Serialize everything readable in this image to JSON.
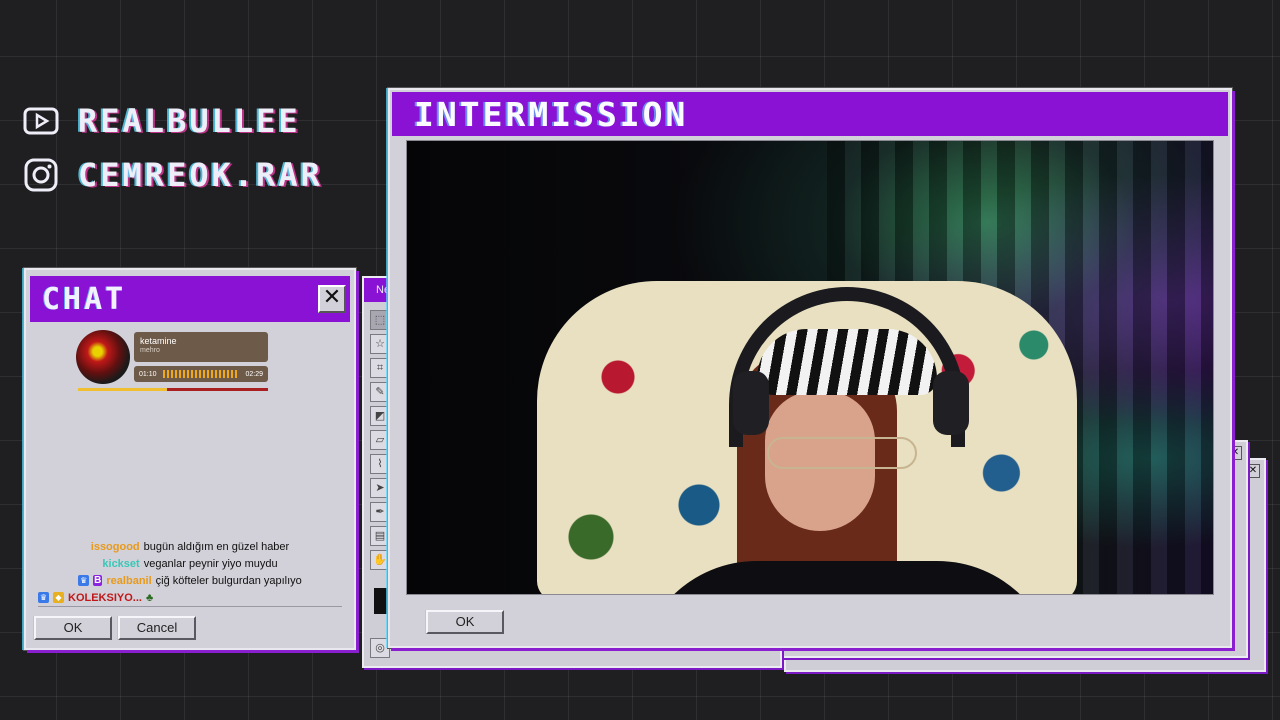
{
  "social": {
    "youtube": {
      "icon": "youtube-icon",
      "handle": "REALBULLEE"
    },
    "instagram": {
      "icon": "instagram-icon",
      "handle": "CEMREOK.RAR"
    }
  },
  "paint": {
    "title": "Ne"
  },
  "chat": {
    "title": "CHAT",
    "close_glyph": "✕",
    "now_playing": {
      "track": "ketamine",
      "artist": "mehro",
      "elapsed": "01:10",
      "duration": "02:29",
      "progress": 0.47
    },
    "messages": [
      {
        "user": "issogood",
        "user_color": "#e89a1a",
        "badges": [],
        "text": "bugün aldığım en güzel haber"
      },
      {
        "user": "kickset",
        "user_color": "#38c8b8",
        "badges": [],
        "text": "veganlar peynir yiyo muydu"
      },
      {
        "user": "realbanil",
        "user_color": "#e89a1a",
        "badges": [
          "prime",
          "sub"
        ],
        "text": "çiğ köfteler bulgurdan yapılıyo"
      },
      {
        "user": "KOLEKSIYO...",
        "user_color": "#c01818",
        "badges": [
          "prime",
          "gold"
        ],
        "text": ""
      }
    ],
    "ok_label": "OK",
    "cancel_label": "Cancel"
  },
  "intermission": {
    "title": "INTERMISSION",
    "ok_label": "OK"
  },
  "colors": {
    "accent": "#8a12d4",
    "window_bg": "#d2d0d8",
    "page_bg": "#1f1f21"
  }
}
